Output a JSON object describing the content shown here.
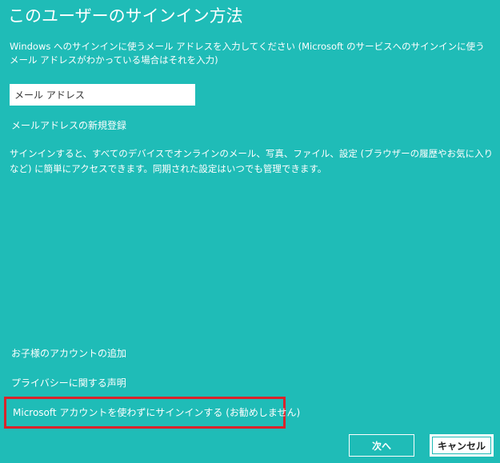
{
  "page": {
    "title": "このユーザーのサインイン方法",
    "description": "Windows へのサインインに使うメール アドレスを入力してください (Microsoft のサービスへのサインインに使うメール アドレスがわかっている場合はそれを入力)",
    "info": "サインインすると、すべてのデバイスでオンラインのメール、写真、ファイル、設定 (ブラウザーの履歴やお気に入りなど) に簡単にアクセスできます。同期された設定はいつでも管理できます。"
  },
  "form": {
    "email_placeholder": "メール アドレス",
    "email_value": ""
  },
  "links": {
    "register": "メールアドレスの新規登録",
    "add_child": "お子様のアカウントの追加",
    "privacy": "プライバシーに関する声明",
    "local_account": "Microsoft アカウントを使わずにサインインする (お勧めしません)"
  },
  "colors": {
    "background": "#1fbcb7",
    "highlight": "#d9242b"
  },
  "buttons": {
    "next": "次へ",
    "cancel": "キャンセル"
  }
}
